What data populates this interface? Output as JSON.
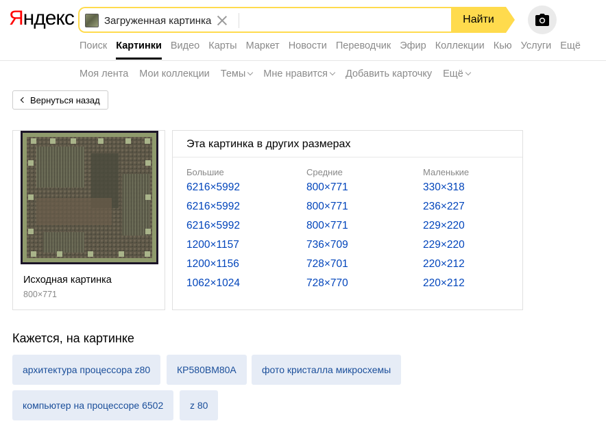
{
  "logo": {
    "first_letter": "Я",
    "rest": "ндекс"
  },
  "search": {
    "chip_label": "Загруженная картинка",
    "find_label": "Найти"
  },
  "services": [
    {
      "label": "Поиск",
      "active": false
    },
    {
      "label": "Картинки",
      "active": true
    },
    {
      "label": "Видео",
      "active": false
    },
    {
      "label": "Карты",
      "active": false
    },
    {
      "label": "Маркет",
      "active": false
    },
    {
      "label": "Новости",
      "active": false
    },
    {
      "label": "Переводчик",
      "active": false
    },
    {
      "label": "Эфир",
      "active": false
    },
    {
      "label": "Коллекции",
      "active": false
    },
    {
      "label": "Кью",
      "active": false
    },
    {
      "label": "Услуги",
      "active": false
    },
    {
      "label": "Ещё",
      "active": false
    }
  ],
  "subnav": [
    {
      "label": "Моя лента",
      "dropdown": false
    },
    {
      "label": "Мои коллекции",
      "dropdown": false
    },
    {
      "label": "Темы",
      "dropdown": true
    },
    {
      "label": "Мне нравится",
      "dropdown": true
    },
    {
      "label": "Добавить карточку",
      "dropdown": false
    },
    {
      "label": "Ещё",
      "dropdown": true
    }
  ],
  "back_label": "Вернуться назад",
  "original": {
    "caption": "Исходная картинка",
    "size": "800×771"
  },
  "sizes": {
    "title": "Эта картинка в других размерах",
    "columns": [
      {
        "head": "Большие",
        "items": [
          "6216×5992",
          "6216×5992",
          "6216×5992",
          "1200×1157",
          "1200×1156",
          "1062×1024"
        ]
      },
      {
        "head": "Средние",
        "items": [
          "800×771",
          "800×771",
          "800×771",
          "736×709",
          "728×701",
          "728×770"
        ]
      },
      {
        "head": "Маленькие",
        "items": [
          "330×318",
          "236×227",
          "229×220",
          "229×220",
          "220×212",
          "220×212"
        ]
      }
    ]
  },
  "tags": {
    "title": "Кажется, на картинке",
    "items": [
      "архитектура процессора z80",
      "КР580ВМ80А",
      "фото кристалла микросхемы",
      "компьютер на процессоре 6502",
      "z 80"
    ]
  },
  "colors": {
    "accent": "#ffdb4d",
    "link": "#04b",
    "tag_bg": "#e6ecf6"
  }
}
